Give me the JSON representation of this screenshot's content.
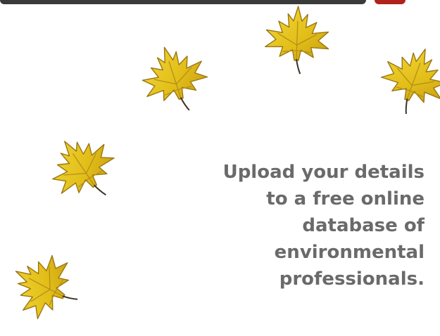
{
  "tagline": {
    "lines": [
      "Upload your details",
      "to a free online",
      "database of",
      "environmental",
      "professionals."
    ]
  },
  "decoration": {
    "leaf_icon": "maple-leaf-icon",
    "leaf_fill": "#e8c41a",
    "leaf_stroke": "#8a6a10",
    "header_dark": "#3a3a3a",
    "header_accent": "#b0221b"
  }
}
